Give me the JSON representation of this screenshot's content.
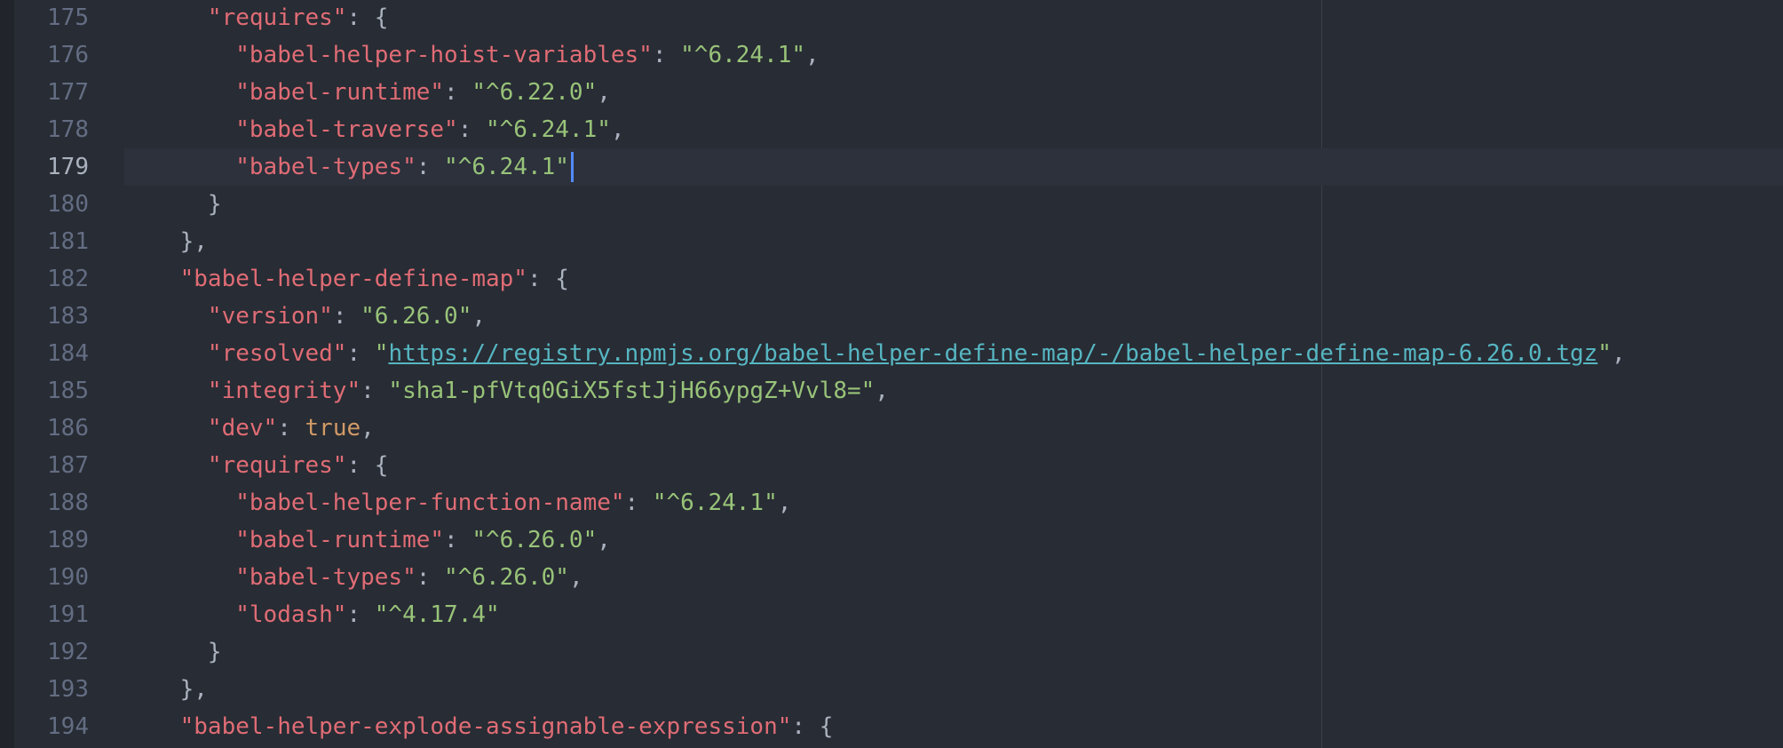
{
  "editor": {
    "colors": {
      "background": "#282c34",
      "key": "#e06c75",
      "string": "#98c379",
      "url": "#56b6c2",
      "boolean": "#d19a66",
      "punctuation": "#abb2bf",
      "line_number": "#636d83",
      "cursor": "#528bff"
    },
    "active_line": "179",
    "lines": [
      {
        "num": "175",
        "indent": "      ",
        "key": "\"requires\"",
        "sep": ": ",
        "open": "{"
      },
      {
        "num": "176",
        "indent": "        ",
        "key": "\"babel-helper-hoist-variables\"",
        "sep": ": ",
        "val": "\"^6.24.1\"",
        "end": ","
      },
      {
        "num": "177",
        "indent": "        ",
        "key": "\"babel-runtime\"",
        "sep": ": ",
        "val": "\"^6.22.0\"",
        "end": ","
      },
      {
        "num": "178",
        "indent": "        ",
        "key": "\"babel-traverse\"",
        "sep": ": ",
        "val": "\"^6.24.1\"",
        "end": ","
      },
      {
        "num": "179",
        "indent": "        ",
        "key": "\"babel-types\"",
        "sep": ": ",
        "val": "\"^6.24.1\"",
        "end": ""
      },
      {
        "num": "180",
        "indent": "      ",
        "close": "}"
      },
      {
        "num": "181",
        "indent": "    ",
        "close": "},"
      },
      {
        "num": "182",
        "indent": "    ",
        "key": "\"babel-helper-define-map\"",
        "sep": ": ",
        "open": "{"
      },
      {
        "num": "183",
        "indent": "      ",
        "key": "\"version\"",
        "sep": ": ",
        "val": "\"6.26.0\"",
        "end": ","
      },
      {
        "num": "184",
        "indent": "      ",
        "key": "\"resolved\"",
        "sep": ": ",
        "q1": "\"",
        "url": "https://registry.npmjs.org/babel-helper-define-map/-/babel-helper-define-map-6.26.0.tgz",
        "q2": "\"",
        "end": ","
      },
      {
        "num": "185",
        "indent": "      ",
        "key": "\"integrity\"",
        "sep": ": ",
        "val": "\"sha1-pfVtq0GiX5fstJjH66ypgZ+Vvl8=\"",
        "end": ","
      },
      {
        "num": "186",
        "indent": "      ",
        "key": "\"dev\"",
        "sep": ": ",
        "bool": "true",
        "end": ","
      },
      {
        "num": "187",
        "indent": "      ",
        "key": "\"requires\"",
        "sep": ": ",
        "open": "{"
      },
      {
        "num": "188",
        "indent": "        ",
        "key": "\"babel-helper-function-name\"",
        "sep": ": ",
        "val": "\"^6.24.1\"",
        "end": ","
      },
      {
        "num": "189",
        "indent": "        ",
        "key": "\"babel-runtime\"",
        "sep": ": ",
        "val": "\"^6.26.0\"",
        "end": ","
      },
      {
        "num": "190",
        "indent": "        ",
        "key": "\"babel-types\"",
        "sep": ": ",
        "val": "\"^6.26.0\"",
        "end": ","
      },
      {
        "num": "191",
        "indent": "        ",
        "key": "\"lodash\"",
        "sep": ": ",
        "val": "\"^4.17.4\"",
        "end": ""
      },
      {
        "num": "192",
        "indent": "      ",
        "close": "}"
      },
      {
        "num": "193",
        "indent": "    ",
        "close": "},"
      },
      {
        "num": "194",
        "indent": "    ",
        "key": "\"babel-helper-explode-assignable-expression\"",
        "sep": ": ",
        "open": "{"
      }
    ]
  }
}
